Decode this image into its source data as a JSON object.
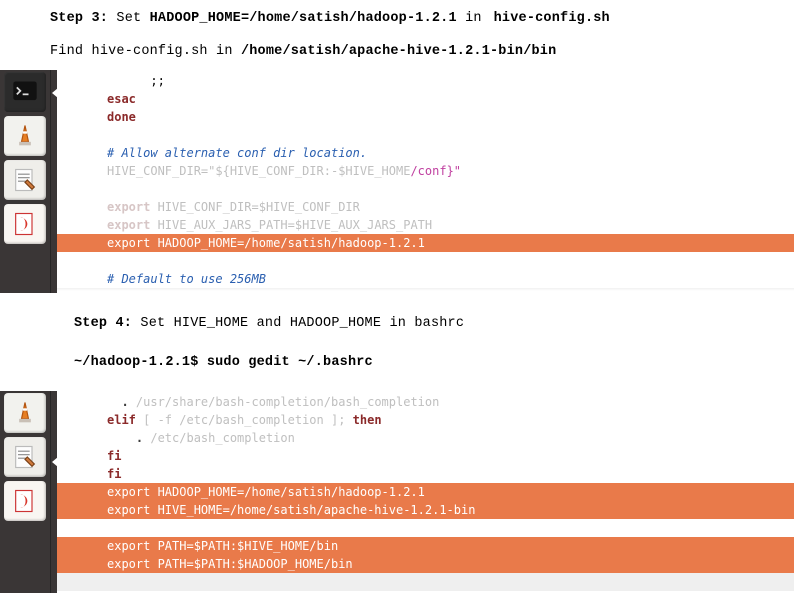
{
  "step3": {
    "label": "Step 3:",
    "set": " Set ",
    "assign": "HADOOP_HOME=/home/satish/hadoop-1.2.1",
    "in": " in ",
    "file": "hive-config.sh"
  },
  "find_line": {
    "prefix": "Find ",
    "file1": "hive-config.sh",
    "mid": " in ",
    "path": "/home/satish/apache-hive-1.2.1-bin/bin"
  },
  "editor1": {
    "l1": "      ;;",
    "l2_kw": "esac",
    "l3_kw": "done",
    "blank": " ",
    "cmt1": "# Allow alternate conf dir location.",
    "assign1a": "HIVE_CONF_DIR=",
    "assign1b": "\"${HIVE_CONF_DIR:-$HIVE_HOME",
    "assign1c": "/conf}\"",
    "exp1a": "export",
    "exp1b": " HIVE_CONF_DIR=$HIVE_CONF_DIR",
    "exp2a": "export",
    "exp2b": " HIVE_AUX_JARS_PATH=$HIVE_AUX_JARS_PATH",
    "exp3": "export HADOOP_HOME=/home/satish/hadoop-1.2.1",
    "cmt2": "# Default to use 256MB "
  },
  "step4": {
    "label": "Step 4:",
    "text": " Set HIVE_HOME and HADOOP_HOME in bashrc",
    "cmd": "~/hadoop-1.2.1$ sudo gedit  ~/.bashrc"
  },
  "editor2": {
    "dot1": "  .",
    "path1": " /usr/share/bash-completion/bash_completion",
    "elif": "elif",
    "cond": " [ -f /etc/bash_completion ]; ",
    "then": "then",
    "dot2": "    .",
    "path2": " /etc/bash_completion",
    "fi1": "fi",
    "fi2": "fi",
    "e1": "export HADOOP_HOME=/home/satish/hadoop-1.2.1",
    "e2": "export HIVE_HOME=/home/satish/apache-hive-1.2.1-bin",
    "e3": "export PATH=$PATH:$HIVE_HOME/bin",
    "e4": "export PATH=$PATH:$HADOOP_HOME/bin"
  }
}
